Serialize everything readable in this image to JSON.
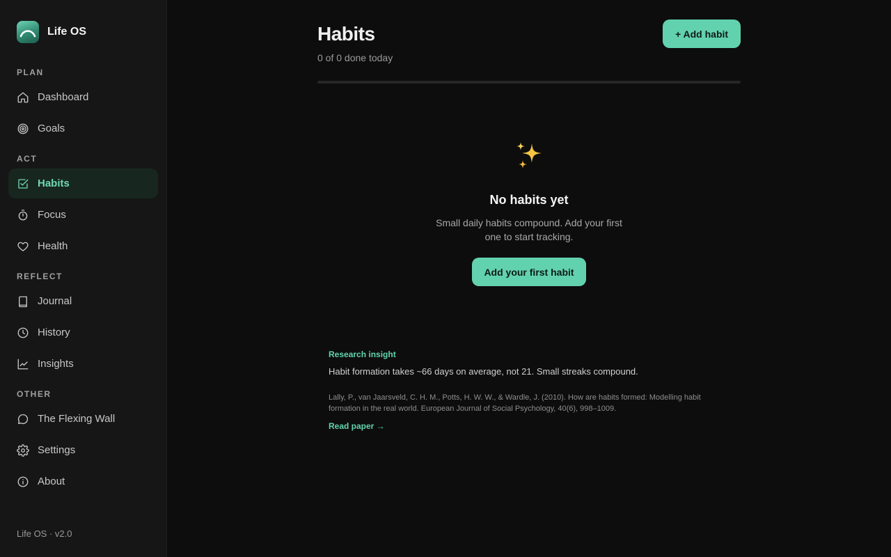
{
  "app": {
    "name": "Life OS",
    "version_label": "Life OS · v2.0",
    "accent_color": "#62d2ae"
  },
  "sidebar": {
    "sections": [
      {
        "label": "PLAN",
        "items": [
          {
            "label": "Dashboard",
            "icon": "home-icon"
          },
          {
            "label": "Goals",
            "icon": "target-icon"
          }
        ]
      },
      {
        "label": "ACT",
        "items": [
          {
            "label": "Habits",
            "icon": "check-square-icon",
            "active": true
          },
          {
            "label": "Focus",
            "icon": "timer-icon"
          },
          {
            "label": "Health",
            "icon": "heart-icon"
          }
        ]
      },
      {
        "label": "REFLECT",
        "items": [
          {
            "label": "Journal",
            "icon": "book-icon"
          },
          {
            "label": "History",
            "icon": "clock-icon"
          },
          {
            "label": "Insights",
            "icon": "chart-line-icon"
          }
        ]
      },
      {
        "label": "OTHER",
        "items": [
          {
            "label": "The Flexing Wall",
            "icon": "chat-bubble-icon"
          },
          {
            "label": "Settings",
            "icon": "gear-icon"
          },
          {
            "label": "About",
            "icon": "info-icon"
          }
        ]
      }
    ]
  },
  "main": {
    "title": "Habits",
    "subtitle": "0 of 0 done today",
    "add_button_label": "+ Add habit",
    "progress_fraction": 0,
    "empty_state": {
      "icon": "sparkles-icon",
      "title": "No habits yet",
      "description": "Small daily habits compound. Add your first one to start tracking.",
      "button_label": "Add your first habit"
    },
    "insight": {
      "label": "Research insight",
      "text": "Habit formation takes ~66 days on average, not 21. Small streaks compound.",
      "citation": "Lally, P., van Jaarsveld, C. H. M., Potts, H. W. W., & Wardle, J. (2010). How are habits formed: Modelling habit formation in the real world. European Journal of Social Psychology, 40(6), 998–1009.",
      "link_label": "Read paper →"
    }
  }
}
